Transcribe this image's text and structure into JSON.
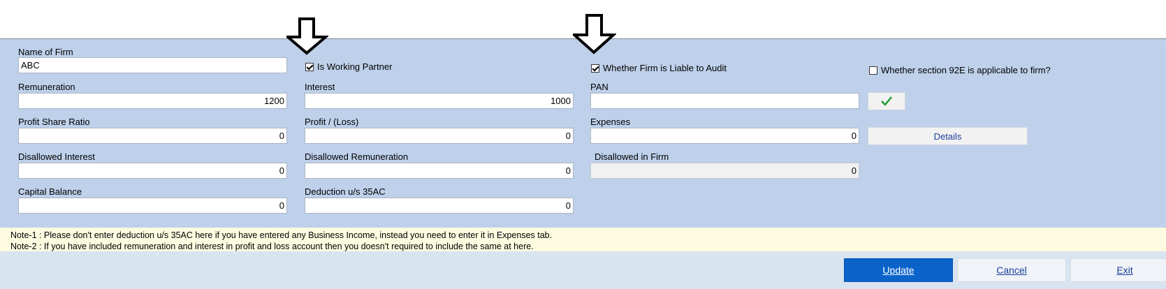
{
  "form": {
    "name_of_firm": {
      "label": "Name of Firm",
      "value": "ABC"
    },
    "is_working_partner": {
      "label": "Is Working Partner",
      "checked": true
    },
    "liable_to_audit": {
      "label": "Whether Firm is Liable to Audit",
      "checked": true
    },
    "section_92e": {
      "label": "Whether section 92E is applicable to firm?",
      "checked": false
    },
    "remuneration": {
      "label": "Remuneration",
      "value": "1200"
    },
    "interest": {
      "label": "Interest",
      "value": "1000"
    },
    "pan": {
      "label": "PAN",
      "value": ""
    },
    "profit_share_ratio": {
      "label": "Profit Share Ratio",
      "value": "0"
    },
    "profit_loss": {
      "label": "Profit / (Loss)",
      "value": "0"
    },
    "expenses": {
      "label": "Expenses",
      "value": "0"
    },
    "details_button": "Details",
    "disallowed_interest": {
      "label": "Disallowed Interest",
      "value": "0"
    },
    "disallowed_remuneration": {
      "label": "Disallowed Remuneration",
      "value": "0"
    },
    "disallowed_in_firm": {
      "label": "Disallowed in Firm",
      "value": "0"
    },
    "capital_balance": {
      "label": "Capital Balance",
      "value": "0"
    },
    "deduction_35ac": {
      "label": "Deduction u/s 35AC",
      "value": "0"
    }
  },
  "notes": {
    "note1": "Note-1 : Please don't enter deduction u/s 35AC here if you have entered any Business Income, instead you need to enter it in Expenses tab.",
    "note2": "Note-2 : If you have included remuneration and interest in profit and loss account then you doesn't required to include the same at here."
  },
  "buttons": {
    "update": "Update",
    "cancel": "Cancel",
    "exit": "Exit"
  },
  "icons": {
    "annotation_arrows": "down-arrow-icon",
    "verify": "checkmark-icon"
  },
  "colors": {
    "form_background": "#bed0ea",
    "notes_background": "#fdfbe0",
    "primary_button": "#0a63c9",
    "checkmark": "#1e9a2e"
  }
}
